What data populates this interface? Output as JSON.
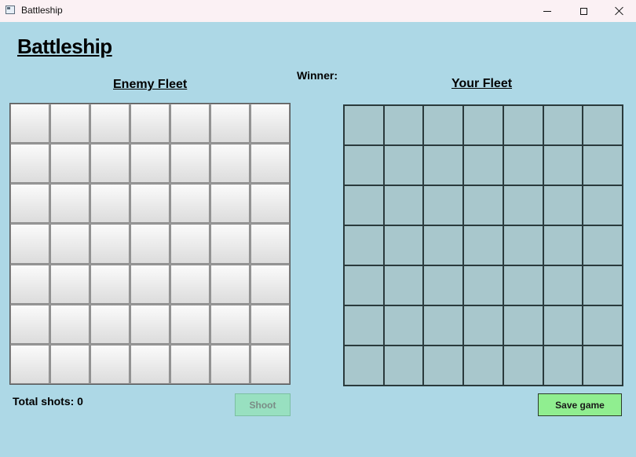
{
  "window": {
    "title": "Battleship",
    "icon": "app-icon",
    "controls": [
      "minimize-icon",
      "maximize-icon",
      "close-icon"
    ]
  },
  "game": {
    "title": "Battleship",
    "winner_label": "Winner:",
    "enemy_fleet_label": "Enemy Fleet",
    "your_fleet_label": "Your Fleet",
    "total_shots_label": "Total shots: 0",
    "shoot_label": "Shoot",
    "save_label": "Save game",
    "grid_rows": 7,
    "grid_cols": 7
  },
  "colors": {
    "background": "#add8e6",
    "own_cell": "#a8c7cc",
    "shoot_button": "#98e0c0",
    "save_button": "#90ee90"
  }
}
